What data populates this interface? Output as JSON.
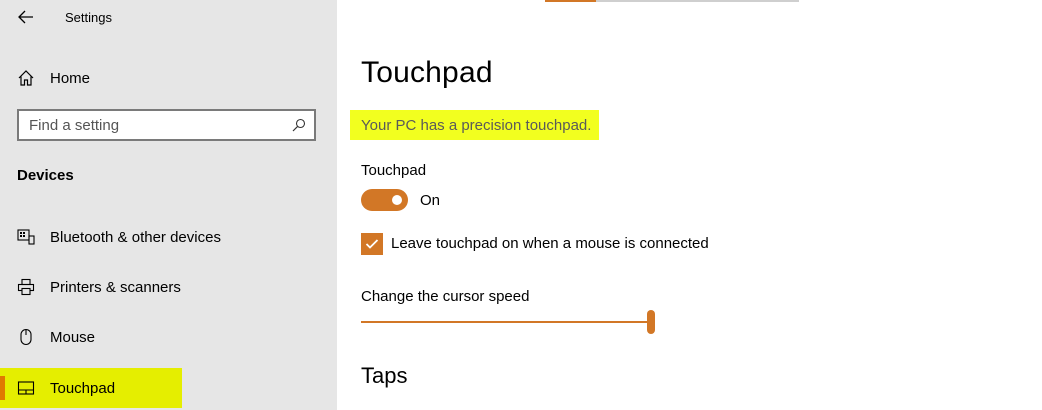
{
  "app": {
    "title": "Settings",
    "back_icon": "back-arrow-icon"
  },
  "sidebar": {
    "home_label": "Home",
    "search_placeholder": "Find a setting",
    "section_title": "Devices",
    "items": [
      {
        "label": "Bluetooth & other devices",
        "icon": "bluetooth-devices-icon"
      },
      {
        "label": "Printers & scanners",
        "icon": "printer-icon"
      },
      {
        "label": "Mouse",
        "icon": "mouse-icon"
      },
      {
        "label": "Touchpad",
        "icon": "touchpad-icon",
        "active": true
      }
    ]
  },
  "main": {
    "title": "Touchpad",
    "precision_text": "Your PC has a precision touchpad.",
    "touchpad_label": "Touchpad",
    "toggle_state": "On",
    "checkbox_label": "Leave touchpad on when a mouse is connected",
    "checkbox_checked": true,
    "cursor_speed_label": "Change the cursor speed",
    "cursor_speed_value": 1.0,
    "taps_heading": "Taps"
  },
  "colors": {
    "accent": "#d27726",
    "highlight": "#f2ff1f",
    "sidebar_bg": "#e6e6e6",
    "active_indicator": "#e07a00"
  }
}
